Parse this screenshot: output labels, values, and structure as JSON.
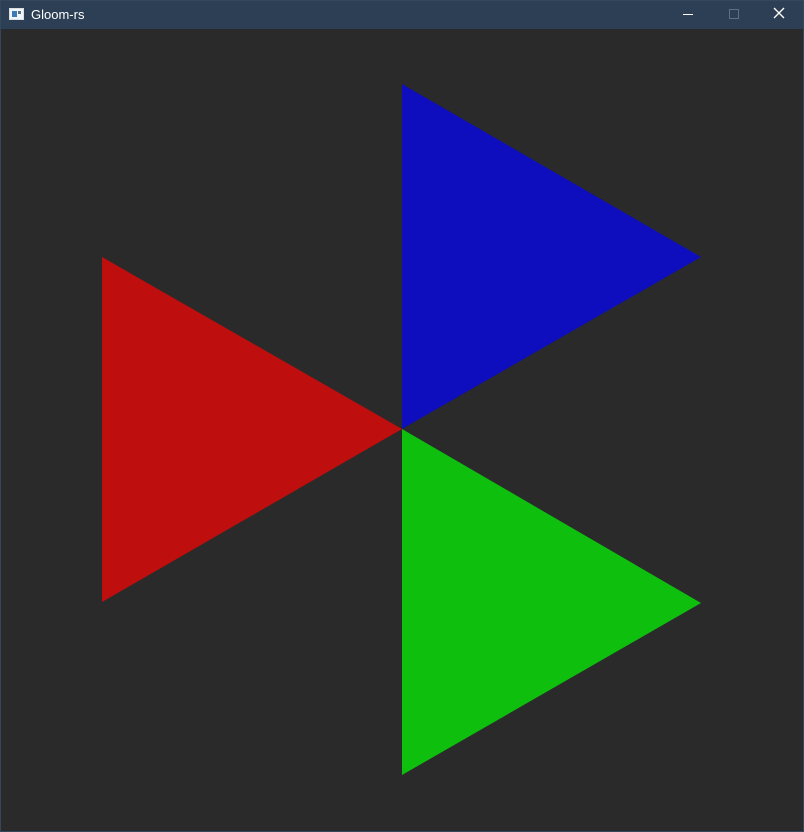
{
  "window": {
    "title": "Gloom-rs",
    "icon": "app-window-icon",
    "controls": [
      {
        "name": "minimize-button",
        "icon": "minimize-icon"
      },
      {
        "name": "maximize-button",
        "icon": "maximize-icon",
        "enabled": false
      },
      {
        "name": "close-button",
        "icon": "close-icon"
      }
    ]
  },
  "viewport": {
    "background_color": "#2a2a2a",
    "triangles": [
      {
        "name": "red-triangle",
        "color": "#bf0e0e"
      },
      {
        "name": "blue-triangle",
        "color": "#0e0ebf"
      },
      {
        "name": "green-triangle",
        "color": "#0ebf0e"
      }
    ]
  }
}
